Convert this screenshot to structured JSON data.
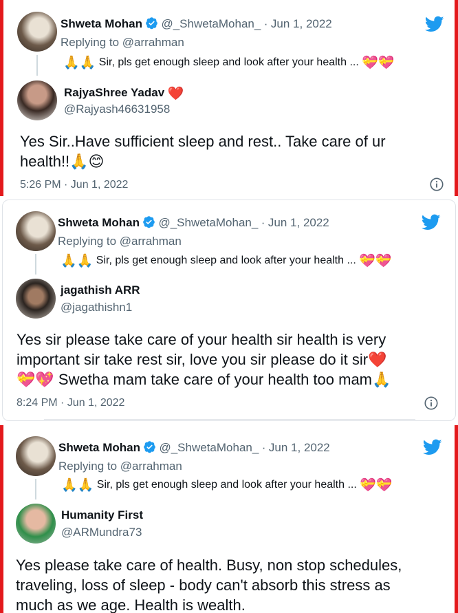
{
  "colors": {
    "accent": "#1d9bf0",
    "frame": "#e3191c",
    "heart": "#f91880"
  },
  "original": {
    "name": "Shweta Mohan",
    "handle": "@_ShwetaMohan_",
    "sep": "·",
    "date": "Jun 1, 2022",
    "replying_prefix": "Replying to",
    "replying_handle": "@arrahman",
    "folded_hands": "🙏🙏",
    "text": "Sir, pls get enough sleep and look after your health ...",
    "trailing_emoji": "💝💝"
  },
  "replies": [
    {
      "name": "RajyaShree Yadav",
      "name_emoji": "❤️",
      "handle": "@Rajyash46631958",
      "text_line1": "Yes Sir..Have sufficient sleep and rest.. Take care of ur",
      "text_line2": "health!!🙏😊",
      "time": "5:26 PM · Jun 1, 2022"
    },
    {
      "name": "jagathish ARR",
      "handle": "@jagathishn1",
      "text_line1": "Yes sir please take care of your health sir health is very",
      "text_line2": "important sir take rest sir, love you sir please do it sir❤️",
      "text_line3": "💝💖  Swetha mam take care of your health too mam🙏",
      "time": "8:24 PM · Jun 1, 2022"
    },
    {
      "name": "Humanity First",
      "handle": "@ARMundra73",
      "text_line1": "Yes please take care of health.  Busy, non stop schedules,",
      "text_line2": "traveling, loss of sleep - body can't absorb this stress as",
      "text_line3": "much as we age.  Health is wealth."
    }
  ],
  "icons": {
    "verified": "verified-badge-icon",
    "bird": "twitter-bird-icon",
    "info": "info-icon"
  }
}
